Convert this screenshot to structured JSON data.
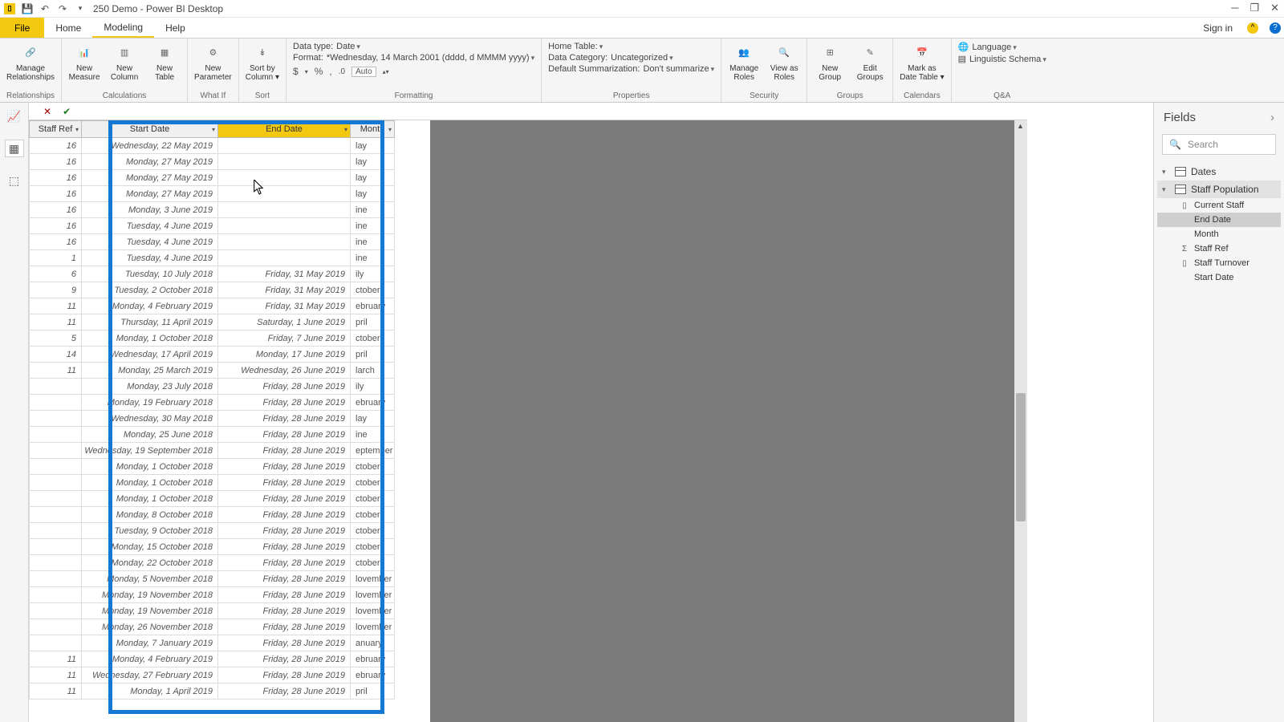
{
  "app": {
    "title": "250 Demo - Power BI Desktop"
  },
  "qat": {
    "pbi": "▮",
    "save": "💾",
    "undo": "↶",
    "redo": "↷",
    "down": "▾"
  },
  "menu": {
    "file": "File",
    "home": "Home",
    "modeling": "Modeling",
    "help": "Help",
    "signin": "Sign in"
  },
  "win": {
    "min": "─",
    "restore": "❐",
    "close": "✕"
  },
  "ribbon": {
    "groups": {
      "relationships": {
        "manage": "Manage\nRelationships",
        "label": "Relationships"
      },
      "calculations": {
        "measure": "New\nMeasure",
        "column": "New\nColumn",
        "table": "New\nTable",
        "label": "Calculations"
      },
      "whatif": {
        "param": "New\nParameter",
        "label": "What If"
      },
      "sort": {
        "sortby": "Sort by\nColumn ▾",
        "label": "Sort"
      },
      "formatting": {
        "datatype_label": "Data type:",
        "datatype_value": "Date",
        "format_label": "Format:",
        "format_value": "*Wednesday, 14 March 2001 (dddd, d MMMM yyyy)",
        "currency": "$",
        "percent": "%",
        "comma": ",",
        "dec": ".0",
        "auto": "Auto",
        "label": "Formatting"
      },
      "properties": {
        "hometable": "Home Table:",
        "datacat_label": "Data Category:",
        "datacat_value": "Uncategorized",
        "summ_label": "Default Summarization:",
        "summ_value": "Don't summarize",
        "label": "Properties"
      },
      "security": {
        "manageroles": "Manage\nRoles",
        "viewas": "View as\nRoles",
        "label": "Security"
      },
      "groupsg": {
        "newgroup": "New\nGroup",
        "editgroups": "Edit\nGroups",
        "label": "Groups"
      },
      "calendars": {
        "markas": "Mark as\nDate Table ▾",
        "label": "Calendars"
      },
      "qa": {
        "language": "Language",
        "schema": "Linguistic Schema",
        "label": "Q&A"
      }
    }
  },
  "grid": {
    "headers": {
      "ref": "Staff Ref",
      "start": "Start Date",
      "end": "End Date",
      "month": "Month"
    },
    "rows": [
      {
        "ref": "16",
        "start": "Wednesday, 22 May 2019",
        "end": "",
        "month": "lay"
      },
      {
        "ref": "16",
        "start": "Monday, 27 May 2019",
        "end": "",
        "month": "lay"
      },
      {
        "ref": "16",
        "start": "Monday, 27 May 2019",
        "end": "",
        "month": "lay"
      },
      {
        "ref": "16",
        "start": "Monday, 27 May 2019",
        "end": "",
        "month": "lay"
      },
      {
        "ref": "16",
        "start": "Monday, 3 June 2019",
        "end": "",
        "month": "ine"
      },
      {
        "ref": "16",
        "start": "Tuesday, 4 June 2019",
        "end": "",
        "month": "ine"
      },
      {
        "ref": "16",
        "start": "Tuesday, 4 June 2019",
        "end": "",
        "month": "ine"
      },
      {
        "ref": "1",
        "start": "Tuesday, 4 June 2019",
        "end": "",
        "month": "ine"
      },
      {
        "ref": "6",
        "start": "Tuesday, 10 July 2018",
        "end": "Friday, 31 May 2019",
        "month": "ily"
      },
      {
        "ref": "9",
        "start": "Tuesday, 2 October 2018",
        "end": "Friday, 31 May 2019",
        "month": "ctober"
      },
      {
        "ref": "11",
        "start": "Monday, 4 February 2019",
        "end": "Friday, 31 May 2019",
        "month": "ebruary"
      },
      {
        "ref": "11",
        "start": "Thursday, 11 April 2019",
        "end": "Saturday, 1 June 2019",
        "month": "pril"
      },
      {
        "ref": "5",
        "start": "Monday, 1 October 2018",
        "end": "Friday, 7 June 2019",
        "month": "ctober"
      },
      {
        "ref": "14",
        "start": "Wednesday, 17 April 2019",
        "end": "Monday, 17 June 2019",
        "month": "pril"
      },
      {
        "ref": "11",
        "start": "Monday, 25 March 2019",
        "end": "Wednesday, 26 June 2019",
        "month": "larch"
      },
      {
        "ref": "",
        "start": "Monday, 23 July 2018",
        "end": "Friday, 28 June 2019",
        "month": "ily"
      },
      {
        "ref": "",
        "start": "Monday, 19 February 2018",
        "end": "Friday, 28 June 2019",
        "month": "ebruary"
      },
      {
        "ref": "",
        "start": "Wednesday, 30 May 2018",
        "end": "Friday, 28 June 2019",
        "month": "lay"
      },
      {
        "ref": "",
        "start": "Monday, 25 June 2018",
        "end": "Friday, 28 June 2019",
        "month": "ine"
      },
      {
        "ref": "",
        "start": "Wednesday, 19 September 2018",
        "end": "Friday, 28 June 2019",
        "month": "eptember"
      },
      {
        "ref": "",
        "start": "Monday, 1 October 2018",
        "end": "Friday, 28 June 2019",
        "month": "ctober"
      },
      {
        "ref": "",
        "start": "Monday, 1 October 2018",
        "end": "Friday, 28 June 2019",
        "month": "ctober"
      },
      {
        "ref": "",
        "start": "Monday, 1 October 2018",
        "end": "Friday, 28 June 2019",
        "month": "ctober"
      },
      {
        "ref": "",
        "start": "Monday, 8 October 2018",
        "end": "Friday, 28 June 2019",
        "month": "ctober"
      },
      {
        "ref": "",
        "start": "Tuesday, 9 October 2018",
        "end": "Friday, 28 June 2019",
        "month": "ctober"
      },
      {
        "ref": "",
        "start": "Monday, 15 October 2018",
        "end": "Friday, 28 June 2019",
        "month": "ctober"
      },
      {
        "ref": "",
        "start": "Monday, 22 October 2018",
        "end": "Friday, 28 June 2019",
        "month": "ctober"
      },
      {
        "ref": "",
        "start": "Monday, 5 November 2018",
        "end": "Friday, 28 June 2019",
        "month": "lovember"
      },
      {
        "ref": "",
        "start": "Monday, 19 November 2018",
        "end": "Friday, 28 June 2019",
        "month": "lovember"
      },
      {
        "ref": "",
        "start": "Monday, 19 November 2018",
        "end": "Friday, 28 June 2019",
        "month": "lovember"
      },
      {
        "ref": "",
        "start": "Monday, 26 November 2018",
        "end": "Friday, 28 June 2019",
        "month": "lovember"
      },
      {
        "ref": "",
        "start": "Monday, 7 January 2019",
        "end": "Friday, 28 June 2019",
        "month": "anuary"
      },
      {
        "ref": "11",
        "start": "Monday, 4 February 2019",
        "end": "Friday, 28 June 2019",
        "month": "ebruary"
      },
      {
        "ref": "11",
        "start": "Wednesday, 27 February 2019",
        "end": "Friday, 28 June 2019",
        "month": "ebruary"
      },
      {
        "ref": "11",
        "start": "Monday, 1 April 2019",
        "end": "Friday, 28 June 2019",
        "month": "pril"
      }
    ]
  },
  "fields": {
    "title": "Fields",
    "search": "Search",
    "tables": {
      "dates": "Dates",
      "staffpop": "Staff Population"
    },
    "cols": {
      "currentstaff": "Current Staff",
      "enddate": "End Date",
      "month": "Month",
      "staffref": "Staff Ref",
      "staffturnover": "Staff Turnover",
      "startdate": "Start Date"
    }
  }
}
